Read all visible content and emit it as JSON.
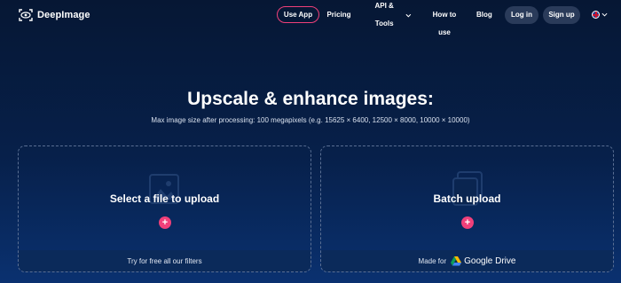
{
  "header": {
    "logo_text": "DeepImage",
    "nav": {
      "use_app": "Use App",
      "pricing": "Pricing",
      "api_tools": "API & Tools",
      "how_to_use": "How to use",
      "blog": "Blog",
      "log_in": "Log in",
      "sign_up": "Sign up"
    }
  },
  "hero": {
    "title": "Upscale & enhance images:",
    "subtitle": "Max image size after processing: 100 megapixels (e.g. 15625 × 6400, 12500 × 8000, 10000 × 10000)"
  },
  "cards": {
    "single": {
      "label": "Select a file to upload",
      "footer": "Try for free all our filters"
    },
    "batch": {
      "label": "Batch upload",
      "footer_prefix": "Made for",
      "footer_brand": "Google Drive"
    }
  },
  "colors": {
    "accent": "#f0407a",
    "background": "#061734"
  },
  "icons": [
    "deepimage-logo-icon",
    "chevron-down-icon",
    "uk-flag-icon",
    "image-placeholder-icon",
    "images-stack-icon",
    "plus-icon",
    "google-drive-icon"
  ]
}
